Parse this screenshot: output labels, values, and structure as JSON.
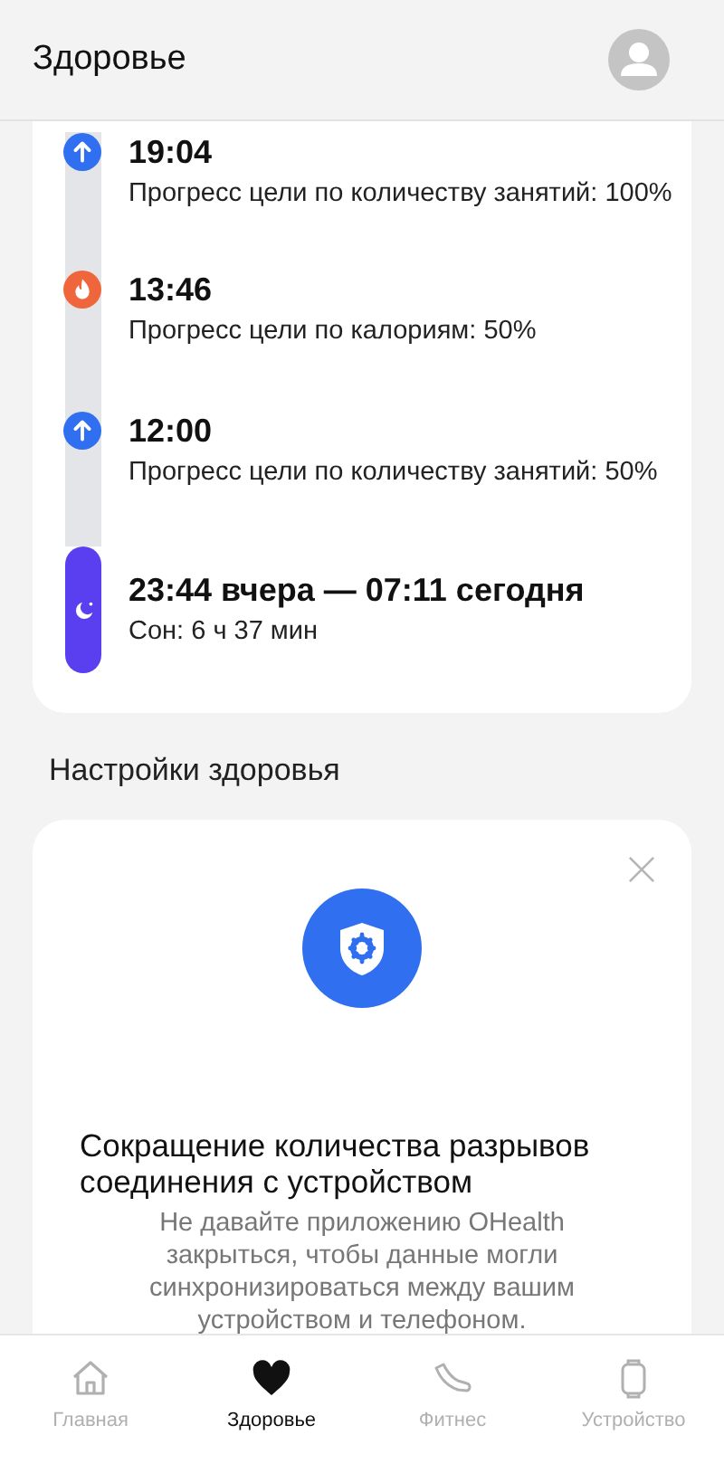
{
  "header": {
    "title": "Здоровье"
  },
  "timeline": [
    {
      "kind": "goal",
      "time": "19:04",
      "text": "Прогресс цели по количеству занятий: 100%"
    },
    {
      "kind": "calories",
      "time": "13:46",
      "text": "Прогресс цели по калориям: 50%"
    },
    {
      "kind": "goal",
      "time": "12:00",
      "text": "Прогресс цели по количеству занятий: 50%"
    },
    {
      "kind": "sleep",
      "time": "23:44 вчера — 07:11 сегодня",
      "text": "Сон: 6 ч 37 мин"
    }
  ],
  "section_title": "Настройки здоровья",
  "tip_card": {
    "title": "Сокращение количества разрывов соединения с устройством",
    "text": "Не давайте приложению OHealth закрыться, чтобы данные могли синхронизироваться между вашим устройством и телефоном."
  },
  "nav": [
    {
      "kind": "home",
      "label": "Главная",
      "selected": false
    },
    {
      "kind": "health",
      "label": "Здоровье",
      "selected": true
    },
    {
      "kind": "fitness",
      "label": "Фитнес",
      "selected": false
    },
    {
      "kind": "device",
      "label": "Устройство",
      "selected": false
    }
  ]
}
